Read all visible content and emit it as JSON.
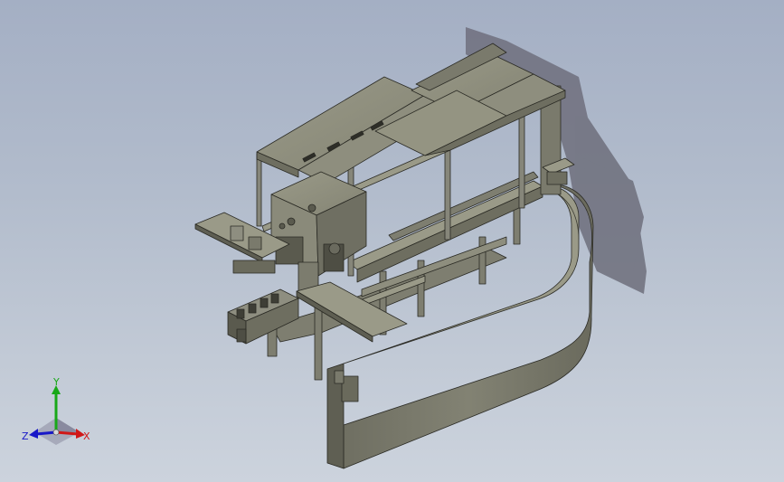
{
  "view": {
    "background_top": "#a4afc4",
    "background_bottom": "#ccd3dd",
    "model_color": "#8c8c7c",
    "model_dark": "#5e5e52",
    "shadow_color": "#6e6f7c"
  },
  "triad": {
    "x_label": "X",
    "y_label": "Y",
    "z_label": "Z",
    "x_color": "#d01818",
    "y_color": "#18a818",
    "z_color": "#1818c8"
  }
}
